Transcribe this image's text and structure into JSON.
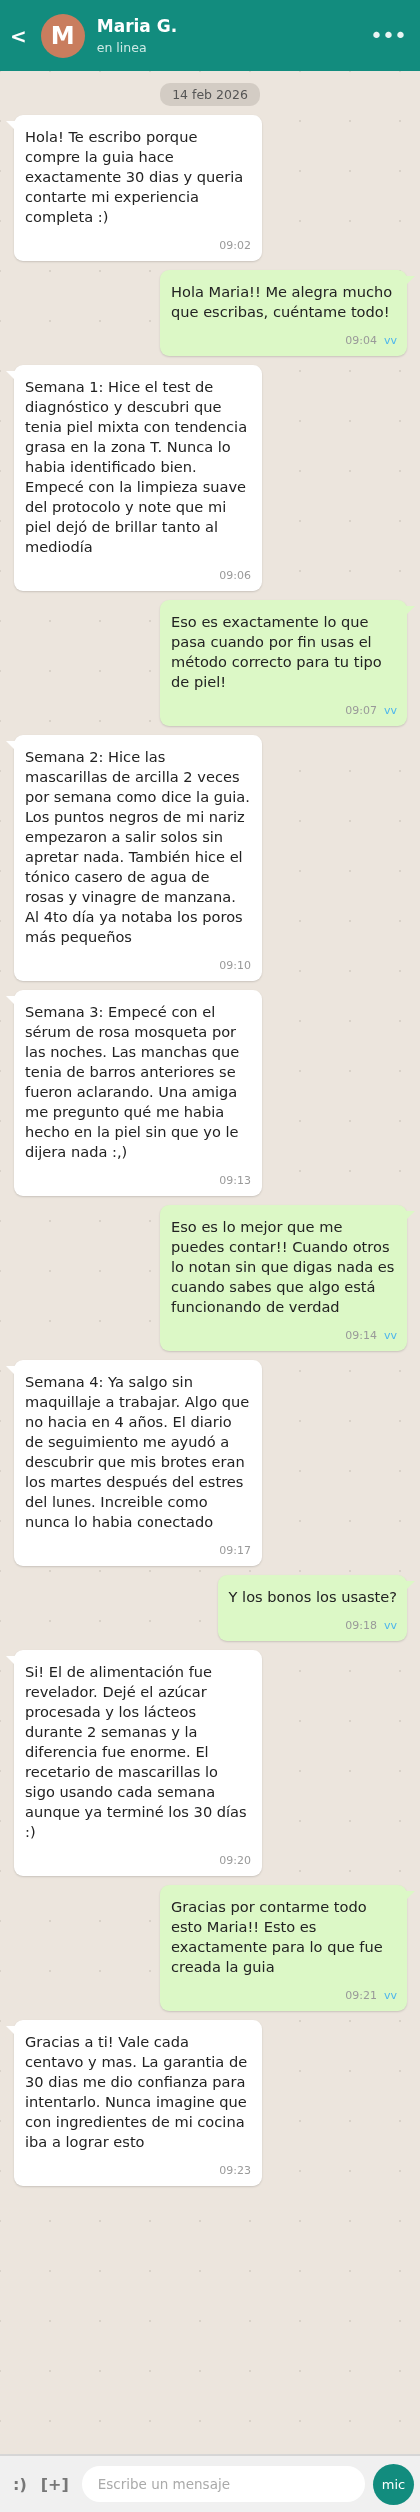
{
  "header": {
    "back": "<",
    "avatar_letter": "M",
    "name": "Maria G.",
    "status": "en linea",
    "menu": "•••"
  },
  "date": "14 feb 2026",
  "messages": [
    {
      "kind": "received",
      "text": "Hola! Te escribo porque compre la guia hace exactamente 30 dias y queria contarte mi experiencia completa :)",
      "time": "09:02"
    },
    {
      "kind": "sent",
      "text": "Hola Maria!! Me alegra mucho que escribas, cuéntame todo!",
      "time": "09:04",
      "ticks": "vv"
    },
    {
      "kind": "received",
      "text": "Semana 1: Hice el test de diagnóstico y descubri que tenia piel mixta con tendencia grasa en la zona T. Nunca lo habia identificado bien. Empecé con la limpieza suave del protocolo y note que mi piel dejó de brillar tanto al mediodía",
      "time": "09:06"
    },
    {
      "kind": "sent",
      "text": "Eso es exactamente lo que pasa cuando por fin usas el método correcto para tu tipo de piel!",
      "time": "09:07",
      "ticks": "vv"
    },
    {
      "kind": "received",
      "text": "Semana 2: Hice las mascarillas de arcilla 2 veces por semana como dice la guia. Los puntos negros de mi nariz empezaron a salir solos sin apretar nada. También hice el tónico casero de agua de rosas y vinagre de manzana. Al 4to día ya notaba los poros más pequeños",
      "time": "09:10"
    },
    {
      "kind": "received",
      "text": "Semana 3: Empecé con el sérum de rosa mosqueta por las noches. Las manchas que tenia de barros anteriores se fueron aclarando. Una amiga me pregunto qué me habia hecho en la piel sin que yo le dijera nada :,)",
      "time": "09:13"
    },
    {
      "kind": "sent",
      "text": "Eso es lo mejor que me puedes contar!! Cuando otros lo notan sin que digas nada es cuando sabes que algo está funcionando de verdad",
      "time": "09:14",
      "ticks": "vv"
    },
    {
      "kind": "received",
      "text": "Semana 4: Ya salgo sin maquillaje a trabajar. Algo que no hacia en 4 años. El diario de seguimiento me ayudó a descubrir que mis brotes eran los martes después del estres del lunes. Increible como nunca lo habia conectado",
      "time": "09:17"
    },
    {
      "kind": "sent",
      "text": "Y los bonos los usaste?",
      "time": "09:18",
      "ticks": "vv"
    },
    {
      "kind": "received",
      "text": "Si! El de alimentación fue revelador. Dejé el azúcar procesada y los lácteos durante 2 semanas y la diferencia fue enorme. El recetario de mascarillas lo sigo usando cada semana aunque ya terminé los 30 días :)",
      "time": "09:20"
    },
    {
      "kind": "sent",
      "text": "Gracias por contarme todo esto Maria!! Esto es exactamente para lo que fue creada la guia",
      "time": "09:21",
      "ticks": "vv"
    },
    {
      "kind": "received",
      "text": "Gracias a ti! Vale cada centavo y mas. La garantia de 30 dias me dio confianza para intentarlo. Nunca imagine que con ingredientes de mi cocina iba a lograr esto",
      "time": "09:23"
    }
  ],
  "composer": {
    "emoji": ":)",
    "attach": "[+]",
    "placeholder": "Escribe un mensaje",
    "mic": "mic"
  }
}
